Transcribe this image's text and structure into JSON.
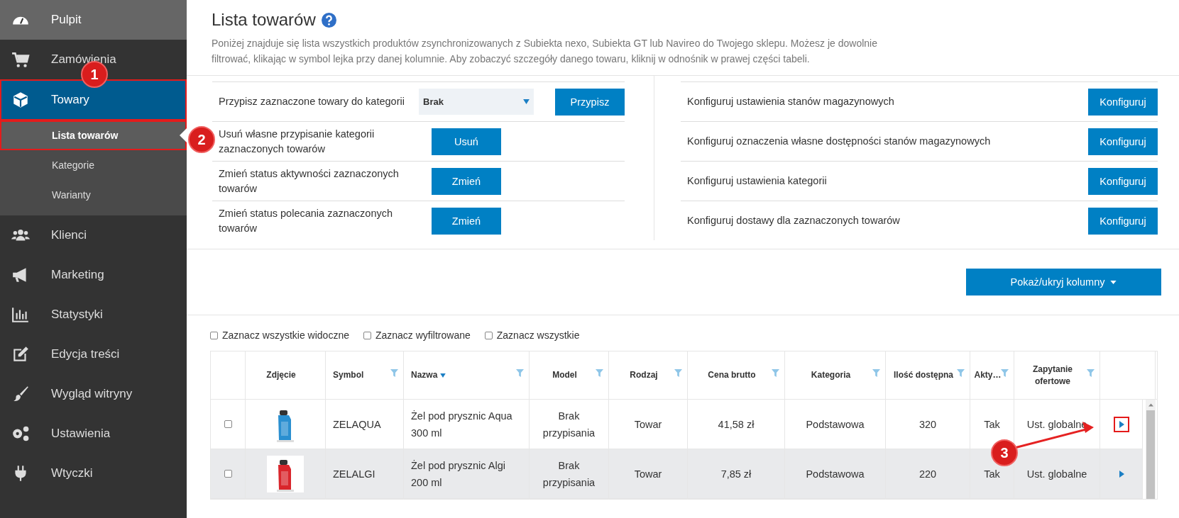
{
  "sidebar": {
    "items": [
      {
        "label": "Pulpit",
        "selected": false,
        "outlined": false
      },
      {
        "label": "Zamówienia",
        "selected": false,
        "outlined": false
      },
      {
        "label": "Towary",
        "selected": true,
        "outlined": true,
        "expanded": true,
        "children": [
          {
            "label": "Lista towarów",
            "selected": true,
            "outlined": true
          },
          {
            "label": "Kategorie",
            "selected": false,
            "outlined": false
          },
          {
            "label": "Warianty",
            "selected": false,
            "outlined": false
          }
        ]
      },
      {
        "label": "Klienci",
        "selected": false,
        "outlined": false
      },
      {
        "label": "Marketing",
        "selected": false,
        "outlined": false
      },
      {
        "label": "Statystyki",
        "selected": false,
        "outlined": false
      },
      {
        "label": "Edycja treści",
        "selected": false,
        "outlined": false
      },
      {
        "label": "Wygląd witryny",
        "selected": false,
        "outlined": false
      },
      {
        "label": "Ustawienia",
        "selected": false,
        "outlined": false
      },
      {
        "label": "Wtyczki",
        "selected": false,
        "outlined": false
      }
    ]
  },
  "page": {
    "title": "Lista towarów",
    "description": "Poniżej znajduje się lista wszystkich produktów zsynchronizowanych z Subiekta nexo, Subiekta GT lub Navireo do Twojego sklepu. Możesz je dowolnie filtrować, klikając w symbol lejka przy danej kolumnie. Aby zobaczyć szczegóły danego towaru, kliknij w odnośnik w prawej części tabeli."
  },
  "actions_left": [
    {
      "kind": "select",
      "label": "Przypisz zaznaczone towary do kategorii",
      "value": "Brak",
      "button": "Przypisz"
    },
    {
      "kind": "plain",
      "label": "Usuń własne przypisanie kategorii zaznaczonych towarów",
      "button": "Usuń"
    },
    {
      "kind": "plain",
      "label": "Zmień status aktywności zaznaczonych towarów",
      "button": "Zmień"
    },
    {
      "kind": "plain",
      "label": "Zmień status polecania zaznaczonych towarów",
      "button": "Zmień"
    }
  ],
  "actions_right": [
    {
      "kind": "plain",
      "label": "Konfiguruj ustawienia stanów magazynowych",
      "button": "Konfiguruj"
    },
    {
      "kind": "plain",
      "label": "Konfiguruj oznaczenia własne dostępności stanów magazynowych",
      "button": "Konfiguruj"
    },
    {
      "kind": "plain",
      "label": "Konfiguruj ustawienia kategorii",
      "button": "Konfiguruj"
    },
    {
      "kind": "plain",
      "label": "Konfiguruj dostawy dla zaznaczonych towarów",
      "button": "Konfiguruj"
    }
  ],
  "columns_button": "Pokaż/ukryj kolumny",
  "select_options": [
    {
      "label": "Zaznacz wszystkie widoczne",
      "checked": false
    },
    {
      "label": "Zaznacz wyfiltrowane",
      "checked": false
    },
    {
      "label": "Zaznacz wszystkie",
      "checked": false
    }
  ],
  "table": {
    "columns": [
      {
        "label": "Zdjęcie",
        "filter": false,
        "sorted": false
      },
      {
        "label": "Symbol",
        "filter": true,
        "sorted": false
      },
      {
        "label": "Nazwa",
        "filter": true,
        "sorted": true
      },
      {
        "label": "Model",
        "filter": true,
        "sorted": false
      },
      {
        "label": "Rodzaj",
        "filter": true,
        "sorted": false
      },
      {
        "label": "Cena brutto",
        "filter": true,
        "sorted": false
      },
      {
        "label": "Kategoria",
        "filter": true,
        "sorted": false
      },
      {
        "label": "Ilość dostępna",
        "filter": true,
        "sorted": false
      },
      {
        "label": "Akty…",
        "filter": true,
        "sorted": false
      },
      {
        "label": "Zapytanie ofertowe",
        "filter": true,
        "sorted": false
      }
    ],
    "rows": [
      {
        "checked": false,
        "highlighted": false,
        "outlined": true,
        "cells": [
          "",
          "ZELAQUA",
          "Żel pod prysznic Aqua 300 ml",
          "Brak przypisania",
          "Towar",
          "41,58 zł",
          "Podstawowa",
          "320",
          "Tak",
          "Ust. globalne"
        ]
      },
      {
        "checked": false,
        "highlighted": true,
        "outlined": false,
        "cells": [
          "",
          "ZELALGI",
          "Żel pod prysznic Algi 200 ml",
          "Brak przypisania",
          "Towar",
          "7,85 zł",
          "Podstawowa",
          "220",
          "Tak",
          "Ust. globalne"
        ]
      }
    ]
  },
  "annotations": [
    {
      "number": "1"
    },
    {
      "number": "2"
    },
    {
      "number": "3"
    }
  ]
}
